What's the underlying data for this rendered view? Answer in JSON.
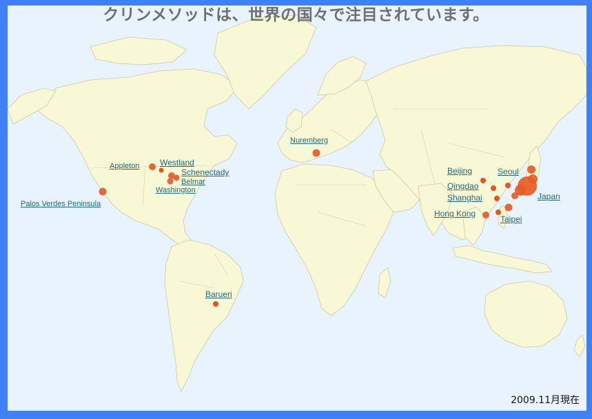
{
  "title": "クリンメソッドは、世界の国々で注目されています。",
  "date_note": "2009.11月現在",
  "colors": {
    "frame": "#3f80f5",
    "ocean": "#e8f3fd",
    "land": "#f8f8d6",
    "marker": "#e8541c",
    "label": "#1f6a7a"
  },
  "cities": {
    "palos_verdes": "Palos Verdes Peninsula",
    "appleton": "Appleton",
    "westland": "Westland",
    "schenectady": "Schenectady",
    "belmar": "Belmar",
    "washington": "Washington",
    "nuremberg": "Nuremberg",
    "barueri": "Barueri",
    "beijing": "Beijing",
    "seoul": "Seoul",
    "qingdao": "Qingdao",
    "shanghai": "Shanghai",
    "japan": "Japan",
    "hong_kong": "Hong Kong",
    "taipei": "Taipei"
  }
}
